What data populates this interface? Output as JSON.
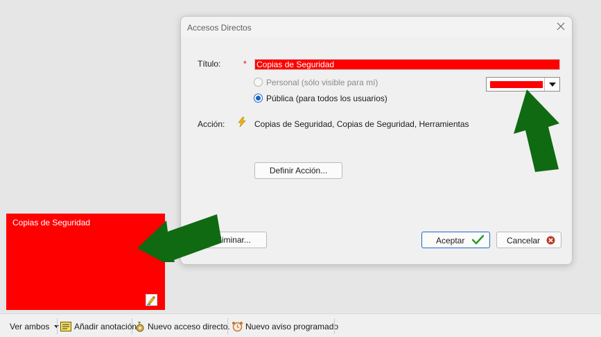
{
  "dialog": {
    "title": "Accesos Directos",
    "title_label": "Título:",
    "required_mark": "*",
    "title_value": "Copias de Seguridad",
    "radio_personal_label": "Personal (sólo visible para mí)",
    "radio_public_label": "Pública (para todos los usuarios)",
    "selected_visibility": "Pública (para todos los usuarios)",
    "color_value": "#ff0000",
    "action_label": "Acción:",
    "action_value": "Copias de Seguridad, Copias de Seguridad, Herramientas",
    "define_action_button": "Definir Acción...",
    "delete_button": "Eliminar...",
    "accept_button": "Aceptar",
    "cancel_button": "Cancelar"
  },
  "tile": {
    "label": "Copias de Seguridad",
    "color": "#ff0000"
  },
  "toolbar": {
    "view_both": "Ver ambos",
    "add_note": "Añadir anotación",
    "new_shortcut": "Nuevo acceso directo.",
    "new_scheduled_alert": "Nuevo aviso programado"
  },
  "colors": {
    "accent": "#1863c6",
    "highlight": "#ff0000",
    "annotation_arrow": "#0f6a12"
  }
}
